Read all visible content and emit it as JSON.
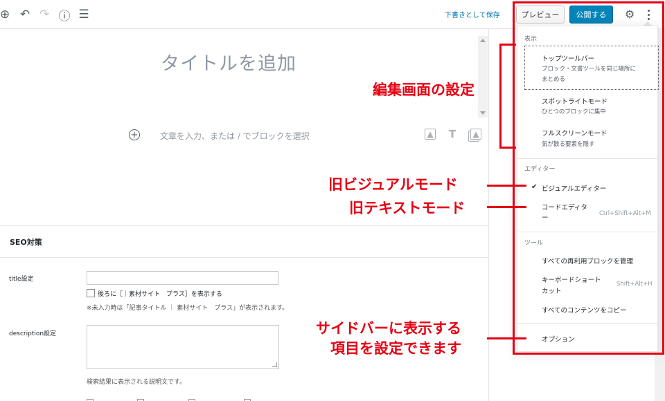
{
  "toolbar": {
    "save_draft": "下書きとして保存",
    "preview": "プレビュー",
    "publish": "公開する"
  },
  "editor": {
    "title_placeholder": "タイトルを追加",
    "paragraph_placeholder": "文章を入力、または / でブロックを選択"
  },
  "seo": {
    "heading": "SEO対策",
    "title_label": "title設定",
    "append_checkbox_label": "後ろに［｜素材サイト　プラス］を表示する",
    "title_note": "※未入力時は「記事タイトル ｜ 素材サイト　プラス」が表示されます。",
    "description_label": "description設定",
    "description_note": "検索結果に表示される説明文です。"
  },
  "menu": {
    "view": {
      "title": "表示",
      "items": [
        {
          "label": "トップツールバー",
          "sub1": "ブロック・文書ツールを同じ場所に",
          "sub2": "まとめる"
        },
        {
          "label": "スポットライトモード",
          "sub1": "ひとつのブロックに集中"
        },
        {
          "label": "フルスクリーンモード",
          "sub1": "気が散る要素を隠す"
        }
      ]
    },
    "editor": {
      "title": "エディター",
      "items": [
        {
          "label": "ビジュアルエディター",
          "checked": true
        },
        {
          "label1": "コードエディタ",
          "label2": "ー",
          "shortcut": "Ctrl+Shift+Alt+M"
        }
      ]
    },
    "tools": {
      "title": "ツール",
      "items": [
        {
          "label": "すべての再利用ブロックを管理"
        },
        {
          "label1": "キーボードショート",
          "label2": "カット",
          "shortcut": "Shift+Alt+H"
        },
        {
          "label": "すべてのコンテンツをコピー"
        }
      ]
    },
    "options": {
      "label": "オプション"
    }
  },
  "annotations": {
    "editor_settings": "編集画面の設定",
    "old_visual": "旧ビジュアルモード",
    "old_text": "旧テキストモード",
    "sidebar_line1": "サイドバーに表示する",
    "sidebar_line2": "項目を設定できます"
  },
  "colors": {
    "annotation_red": "#e60012",
    "publish_blue": "#0085ba",
    "link_blue": "#0073aa"
  },
  "icons": [
    "add-block-icon",
    "undo-icon",
    "redo-icon",
    "info-icon",
    "outline-icon",
    "gear-icon",
    "more-menu-icon",
    "image-icon",
    "heading-icon",
    "gallery-icon"
  ]
}
